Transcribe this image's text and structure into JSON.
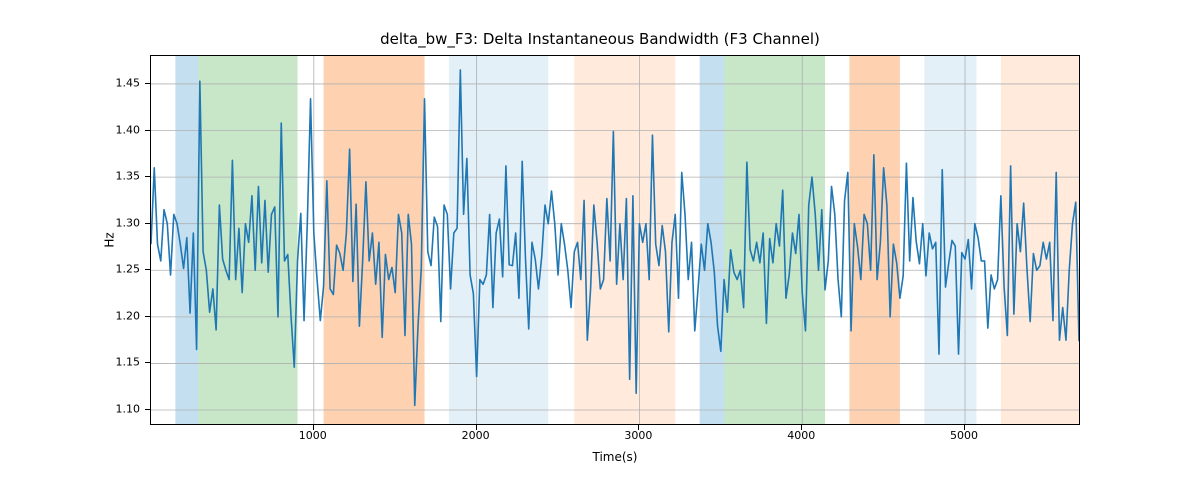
{
  "chart_data": {
    "type": "line",
    "title": "delta_bw_F3: Delta Instantaneous Bandwidth (F3 Channel)",
    "xlabel": "Time(s)",
    "ylabel": "Hz",
    "xlim": [
      0,
      5700
    ],
    "ylim": [
      1.085,
      1.48
    ],
    "xticks": [
      1000,
      2000,
      3000,
      4000,
      5000
    ],
    "yticks": [
      1.1,
      1.15,
      1.2,
      1.25,
      1.3,
      1.35,
      1.4,
      1.45
    ],
    "grid": true,
    "line_color": "#1f77b4",
    "spans": [
      {
        "start": 150,
        "end": 290,
        "color": "#6baed6",
        "alpha": 0.4
      },
      {
        "start": 290,
        "end": 900,
        "color": "#74c476",
        "alpha": 0.4
      },
      {
        "start": 1060,
        "end": 1680,
        "color": "#fd8d3c",
        "alpha": 0.4
      },
      {
        "start": 1830,
        "end": 2440,
        "color": "#6baed6",
        "alpha": 0.18
      },
      {
        "start": 2600,
        "end": 3220,
        "color": "#fd8d3c",
        "alpha": 0.18
      },
      {
        "start": 3370,
        "end": 3520,
        "color": "#6baed6",
        "alpha": 0.4
      },
      {
        "start": 3520,
        "end": 4140,
        "color": "#74c476",
        "alpha": 0.4
      },
      {
        "start": 4290,
        "end": 4600,
        "color": "#fd8d3c",
        "alpha": 0.4
      },
      {
        "start": 4750,
        "end": 5070,
        "color": "#6baed6",
        "alpha": 0.18
      },
      {
        "start": 5220,
        "end": 5700,
        "color": "#fd8d3c",
        "alpha": 0.18
      }
    ],
    "x": [
      0,
      20,
      40,
      60,
      80,
      100,
      120,
      140,
      160,
      180,
      200,
      220,
      240,
      260,
      280,
      300,
      320,
      340,
      360,
      380,
      400,
      420,
      440,
      460,
      480,
      500,
      520,
      540,
      560,
      580,
      600,
      620,
      640,
      660,
      680,
      700,
      720,
      740,
      760,
      780,
      800,
      820,
      840,
      860,
      880,
      900,
      920,
      940,
      960,
      980,
      1000,
      1020,
      1040,
      1060,
      1080,
      1100,
      1120,
      1140,
      1160,
      1180,
      1200,
      1220,
      1240,
      1260,
      1280,
      1300,
      1320,
      1340,
      1360,
      1380,
      1400,
      1420,
      1440,
      1460,
      1480,
      1500,
      1520,
      1540,
      1560,
      1580,
      1600,
      1620,
      1640,
      1660,
      1680,
      1700,
      1720,
      1740,
      1760,
      1780,
      1800,
      1820,
      1840,
      1860,
      1880,
      1900,
      1920,
      1940,
      1960,
      1980,
      2000,
      2020,
      2040,
      2060,
      2080,
      2100,
      2120,
      2140,
      2160,
      2180,
      2200,
      2220,
      2240,
      2260,
      2280,
      2300,
      2320,
      2340,
      2360,
      2380,
      2400,
      2420,
      2440,
      2460,
      2480,
      2500,
      2520,
      2540,
      2560,
      2580,
      2600,
      2620,
      2640,
      2660,
      2680,
      2700,
      2720,
      2740,
      2760,
      2780,
      2800,
      2820,
      2840,
      2860,
      2880,
      2900,
      2920,
      2940,
      2960,
      2980,
      3000,
      3020,
      3040,
      3060,
      3080,
      3100,
      3120,
      3140,
      3160,
      3180,
      3200,
      3220,
      3240,
      3260,
      3280,
      3300,
      3320,
      3340,
      3360,
      3380,
      3400,
      3420,
      3440,
      3460,
      3480,
      3500,
      3520,
      3540,
      3560,
      3580,
      3600,
      3620,
      3640,
      3660,
      3680,
      3700,
      3720,
      3740,
      3760,
      3780,
      3800,
      3820,
      3840,
      3860,
      3880,
      3900,
      3920,
      3940,
      3960,
      3980,
      4000,
      4020,
      4040,
      4060,
      4080,
      4100,
      4120,
      4140,
      4160,
      4180,
      4200,
      4220,
      4240,
      4260,
      4280,
      4300,
      4320,
      4340,
      4360,
      4380,
      4400,
      4420,
      4440,
      4460,
      4480,
      4500,
      4520,
      4540,
      4560,
      4580,
      4600,
      4620,
      4640,
      4660,
      4680,
      4700,
      4720,
      4740,
      4760,
      4780,
      4800,
      4820,
      4840,
      4860,
      4880,
      4900,
      4920,
      4940,
      4960,
      4980,
      5000,
      5020,
      5040,
      5060,
      5080,
      5100,
      5120,
      5140,
      5160,
      5180,
      5200,
      5220,
      5240,
      5260,
      5280,
      5300,
      5320,
      5340,
      5360,
      5380,
      5400,
      5420,
      5440,
      5460,
      5480,
      5500,
      5520,
      5540,
      5560,
      5580,
      5600,
      5620,
      5640,
      5660,
      5680,
      5700
    ],
    "values": [
      1.278,
      1.36,
      1.278,
      1.26,
      1.315,
      1.3,
      1.245,
      1.31,
      1.3,
      1.278,
      1.252,
      1.285,
      1.204,
      1.29,
      1.165,
      1.453,
      1.27,
      1.25,
      1.205,
      1.23,
      1.186,
      1.32,
      1.262,
      1.25,
      1.24,
      1.368,
      1.24,
      1.295,
      1.226,
      1.3,
      1.28,
      1.33,
      1.25,
      1.34,
      1.258,
      1.325,
      1.248,
      1.31,
      1.318,
      1.2,
      1.408,
      1.26,
      1.267,
      1.201,
      1.146,
      1.26,
      1.311,
      1.196,
      1.3,
      1.434,
      1.29,
      1.24,
      1.196,
      1.233,
      1.346,
      1.23,
      1.224,
      1.277,
      1.268,
      1.25,
      1.29,
      1.38,
      1.238,
      1.321,
      1.19,
      1.26,
      1.345,
      1.26,
      1.29,
      1.235,
      1.28,
      1.178,
      1.267,
      1.24,
      1.253,
      1.226,
      1.31,
      1.29,
      1.18,
      1.31,
      1.278,
      1.105,
      1.19,
      1.252,
      1.434,
      1.27,
      1.255,
      1.307,
      1.297,
      1.195,
      1.32,
      1.31,
      1.23,
      1.29,
      1.295,
      1.465,
      1.31,
      1.37,
      1.245,
      1.225,
      1.136,
      1.24,
      1.235,
      1.245,
      1.31,
      1.21,
      1.29,
      1.305,
      1.243,
      1.362,
      1.256,
      1.255,
      1.29,
      1.22,
      1.367,
      1.263,
      1.187,
      1.28,
      1.262,
      1.23,
      1.265,
      1.32,
      1.3,
      1.335,
      1.3,
      1.245,
      1.3,
      1.278,
      1.25,
      1.21,
      1.27,
      1.28,
      1.24,
      1.325,
      1.175,
      1.23,
      1.32,
      1.28,
      1.23,
      1.24,
      1.327,
      1.26,
      1.399,
      1.235,
      1.3,
      1.24,
      1.327,
      1.133,
      1.33,
      1.118,
      1.3,
      1.28,
      1.3,
      1.24,
      1.395,
      1.278,
      1.255,
      1.298,
      1.27,
      1.184,
      1.28,
      1.31,
      1.22,
      1.355,
      1.31,
      1.24,
      1.28,
      1.185,
      1.23,
      1.278,
      1.25,
      1.3,
      1.28,
      1.248,
      1.19,
      1.163,
      1.24,
      1.205,
      1.272,
      1.248,
      1.24,
      1.25,
      1.21,
      1.366,
      1.272,
      1.26,
      1.28,
      1.258,
      1.29,
      1.193,
      1.284,
      1.258,
      1.3,
      1.276,
      1.336,
      1.22,
      1.245,
      1.29,
      1.268,
      1.31,
      1.226,
      1.185,
      1.32,
      1.35,
      1.31,
      1.25,
      1.315,
      1.229,
      1.26,
      1.34,
      1.31,
      1.24,
      1.2,
      1.325,
      1.355,
      1.185,
      1.3,
      1.275,
      1.24,
      1.31,
      1.3,
      1.25,
      1.374,
      1.24,
      1.28,
      1.36,
      1.32,
      1.2,
      1.278,
      1.258,
      1.22,
      1.244,
      1.365,
      1.26,
      1.328,
      1.281,
      1.257,
      1.3,
      1.244,
      1.29,
      1.273,
      1.28,
      1.16,
      1.358,
      1.232,
      1.258,
      1.282,
      1.276,
      1.16,
      1.269,
      1.262,
      1.283,
      1.23,
      1.3,
      1.285,
      1.26,
      1.26,
      1.188,
      1.245,
      1.23,
      1.24,
      1.33,
      1.232,
      1.18,
      1.362,
      1.203,
      1.3,
      1.27,
      1.322,
      1.253,
      1.195,
      1.268,
      1.25,
      1.255,
      1.28,
      1.262,
      1.28,
      1.196,
      1.355,
      1.175,
      1.21,
      1.175,
      1.25,
      1.3,
      1.323,
      1.174
    ]
  }
}
